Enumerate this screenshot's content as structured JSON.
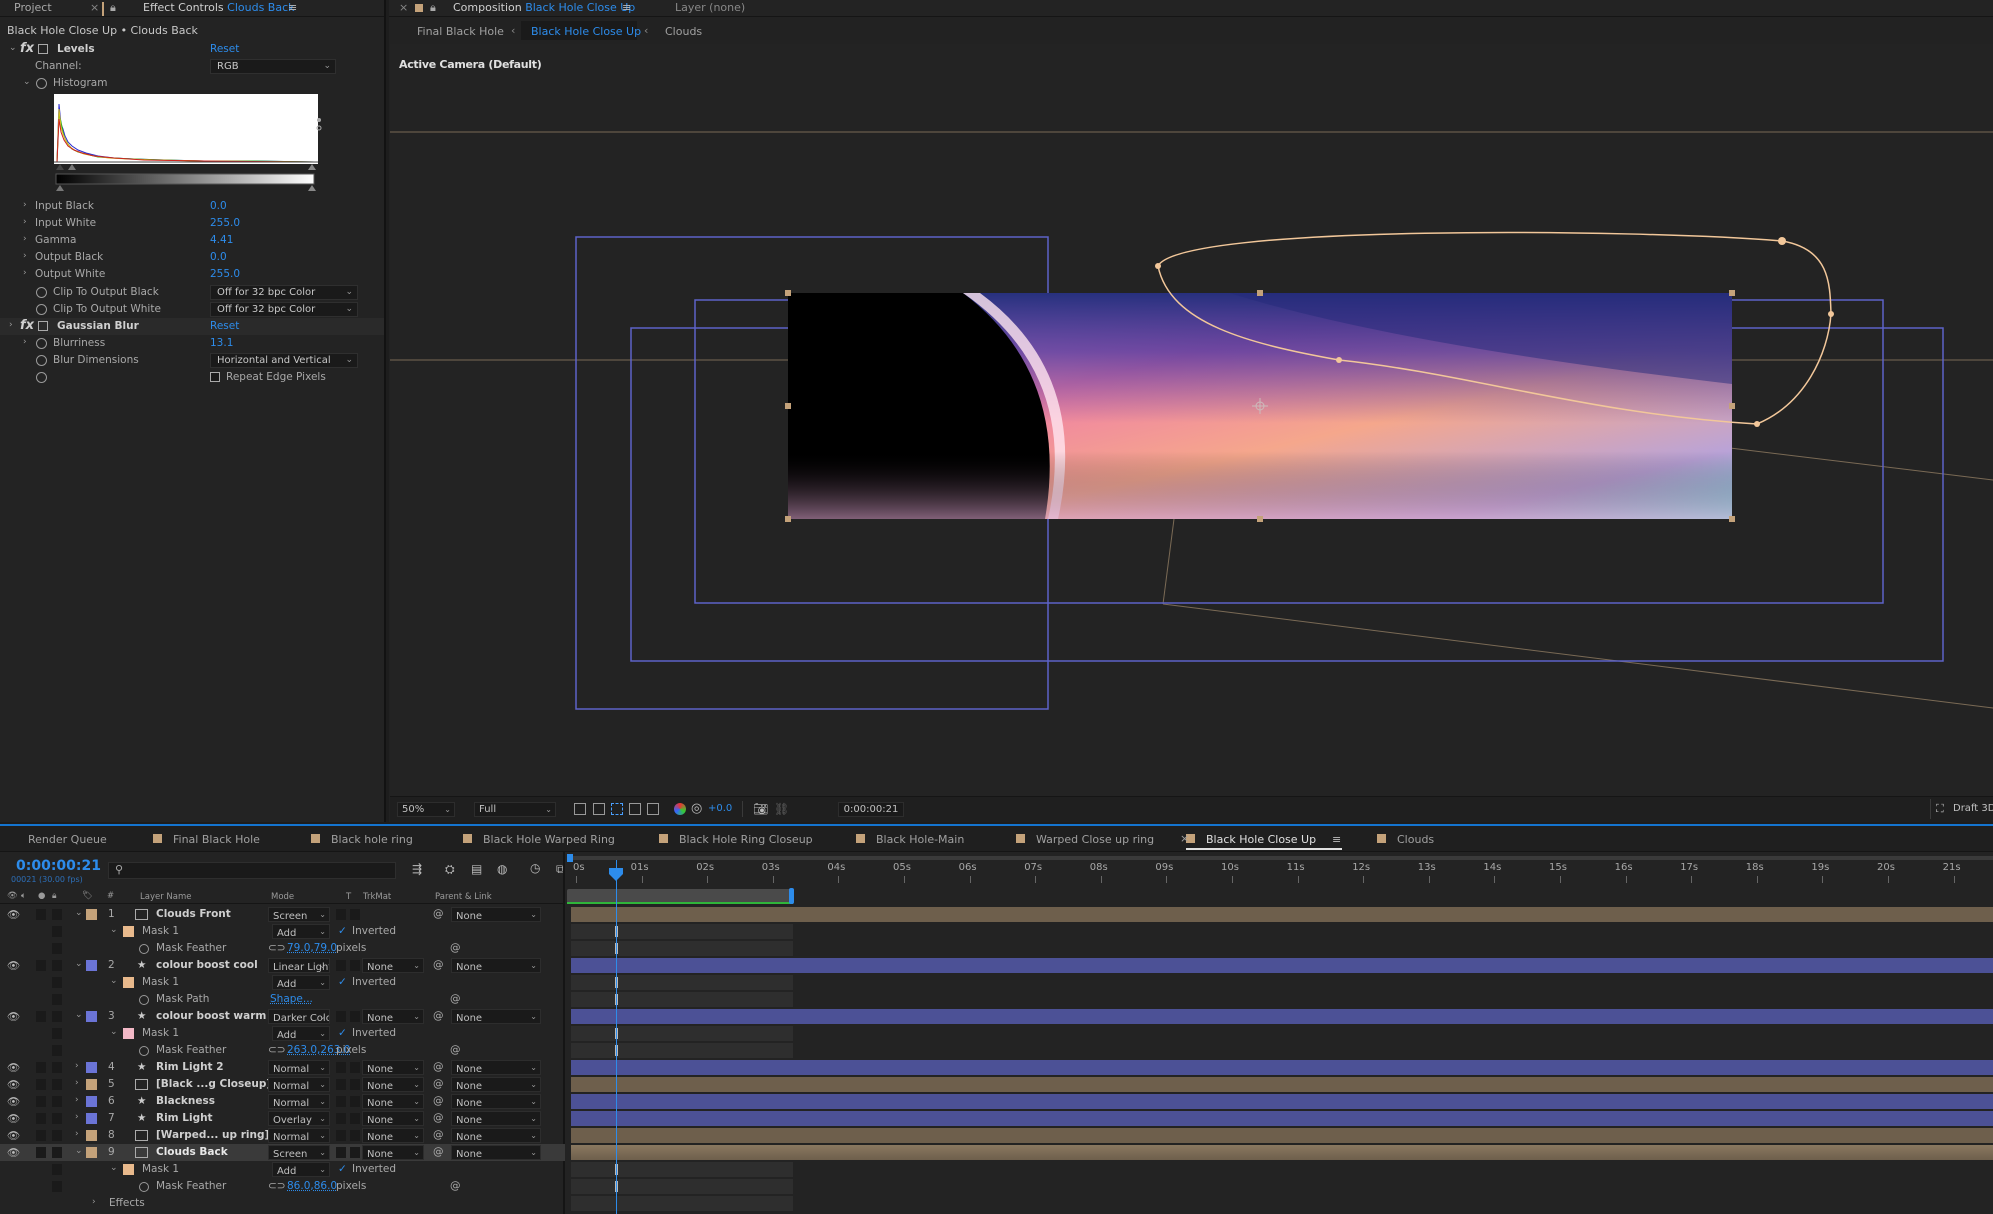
{
  "effect_controls": {
    "tab_project": "Project",
    "tab_effect_prefix": "Effect Controls",
    "tab_effect_layer": "Clouds Back",
    "breadcrumb": "Black Hole Close Up • Clouds Back",
    "levels_name": "Levels",
    "reset": "Reset",
    "channel_label": "Channel:",
    "channel_value": "RGB",
    "histogram_label": "Histogram",
    "props": [
      {
        "label": "Input Black",
        "value": "0.0"
      },
      {
        "label": "Input White",
        "value": "255.0"
      },
      {
        "label": "Gamma",
        "value": "4.41"
      },
      {
        "label": "Output Black",
        "value": "0.0"
      },
      {
        "label": "Output White",
        "value": "255.0"
      }
    ],
    "clip_black_label": "Clip To Output Black",
    "clip_black_value": "Off for 32 bpc Color",
    "clip_white_label": "Clip To Output White",
    "clip_white_value": "Off for 32 bpc Color",
    "gaussian_name": "Gaussian Blur",
    "blurriness_label": "Blurriness",
    "blurriness_value": "13.1",
    "blur_dim_label": "Blur Dimensions",
    "blur_dim_value": "Horizontal and Vertical",
    "repeat_edge_label": "Repeat Edge Pixels"
  },
  "composition": {
    "tab_prefix": "Composition",
    "tab_name": "Black Hole Close Up",
    "layer_tab": "Layer (none)",
    "crumbs": [
      "Final Black Hole",
      "Black Hole Close Up",
      "Clouds"
    ],
    "active_camera": "Active Camera (Default)",
    "zoom": "50%",
    "resolution": "Full",
    "exposure": "+0.0",
    "timecode": "0:00:00:21",
    "draft": "Draft 3D"
  },
  "timeline": {
    "tabs": [
      {
        "label": "Render Queue",
        "color": ""
      },
      {
        "label": "Final Black Hole",
        "color": "#c4a27a"
      },
      {
        "label": "Black hole ring",
        "color": "#c4a27a"
      },
      {
        "label": "Black Hole Warped Ring",
        "color": "#c4a27a"
      },
      {
        "label": "Black Hole Ring Closeup",
        "color": "#c4a27a"
      },
      {
        "label": "Black Hole-Main",
        "color": "#c4a27a"
      },
      {
        "label": "Warped Close up ring",
        "color": "#c4a27a"
      },
      {
        "label": "Black Hole Close Up",
        "color": "#c4a27a"
      },
      {
        "label": "Clouds",
        "color": "#c4a27a"
      }
    ],
    "current_time": "0:00:00:21",
    "frame_info": "00021 (30.00 fps)",
    "search_placeholder": "",
    "col_layer_name": "Layer Name",
    "col_mode": "Mode",
    "col_t": "T",
    "col_trkmat": "TrkMat",
    "col_parent": "Parent & Link",
    "col_hash": "#",
    "ruler": [
      "0s",
      "01s",
      "02s",
      "03s",
      "04s",
      "05s",
      "06s",
      "07s",
      "08s",
      "09s",
      "10s",
      "11s",
      "12s",
      "13s",
      "14s",
      "15s",
      "16s",
      "17s",
      "18s",
      "19s",
      "20s",
      "21s"
    ],
    "rows": [
      {
        "kind": "layer",
        "num": "1",
        "name": "Clouds Front",
        "mode": "Screen",
        "trk": "",
        "parent": "None",
        "color": "#c4a27a",
        "icon": "comp"
      },
      {
        "kind": "mask",
        "name": "Mask 1",
        "mode": "Add",
        "inverted": "Inverted",
        "color": "#e8b98c"
      },
      {
        "kind": "maskprop",
        "name": "Mask Feather",
        "value": "79.0,79.0",
        "unit": "pixels"
      },
      {
        "kind": "layer",
        "num": "2",
        "name": "colour boost cool",
        "mode": "Linear Light",
        "trk": "None",
        "parent": "None",
        "color": "#6b74d6",
        "icon": "star"
      },
      {
        "kind": "mask",
        "name": "Mask 1",
        "mode": "Add",
        "inverted": "Inverted",
        "color": "#e8b98c"
      },
      {
        "kind": "maskprop",
        "name": "Mask Path",
        "value": "Shape...",
        "unit": ""
      },
      {
        "kind": "layer",
        "num": "3",
        "name": "colour boost warm",
        "mode": "Darker Color",
        "trk": "None",
        "parent": "None",
        "color": "#6b74d6",
        "icon": "star"
      },
      {
        "kind": "mask",
        "name": "Mask 1",
        "mode": "Add",
        "inverted": "Inverted",
        "color": "#f2b8c6"
      },
      {
        "kind": "maskprop",
        "name": "Mask Feather",
        "value": "263.0,263.0",
        "unit": "pixels"
      },
      {
        "kind": "layer",
        "num": "4",
        "name": "Rim Light 2",
        "mode": "Normal",
        "trk": "None",
        "parent": "None",
        "color": "#6b74d6",
        "icon": "star"
      },
      {
        "kind": "layer",
        "num": "5",
        "name": "[Black ...g Closeup]",
        "mode": "Normal",
        "trk": "None",
        "parent": "None",
        "color": "#c4a27a",
        "icon": "comp"
      },
      {
        "kind": "layer",
        "num": "6",
        "name": "Blackness",
        "mode": "Normal",
        "trk": "None",
        "parent": "None",
        "color": "#6b74d6",
        "icon": "star"
      },
      {
        "kind": "layer",
        "num": "7",
        "name": "Rim Light",
        "mode": "Overlay",
        "trk": "None",
        "parent": "None",
        "color": "#6b74d6",
        "icon": "star"
      },
      {
        "kind": "layer",
        "num": "8",
        "name": "[Warped... up ring]",
        "mode": "Normal",
        "trk": "None",
        "parent": "None",
        "color": "#c4a27a",
        "icon": "comp"
      },
      {
        "kind": "layer",
        "num": "9",
        "name": "Clouds Back",
        "mode": "Screen",
        "trk": "None",
        "parent": "None",
        "color": "#c4a27a",
        "icon": "comp",
        "selected": true
      },
      {
        "kind": "mask",
        "name": "Mask 1",
        "mode": "Add",
        "inverted": "Inverted",
        "color": "#e8b98c"
      },
      {
        "kind": "maskprop",
        "name": "Mask Feather",
        "value": "86.0,86.0",
        "unit": "pixels"
      },
      {
        "kind": "effects",
        "name": "Effects"
      }
    ]
  }
}
